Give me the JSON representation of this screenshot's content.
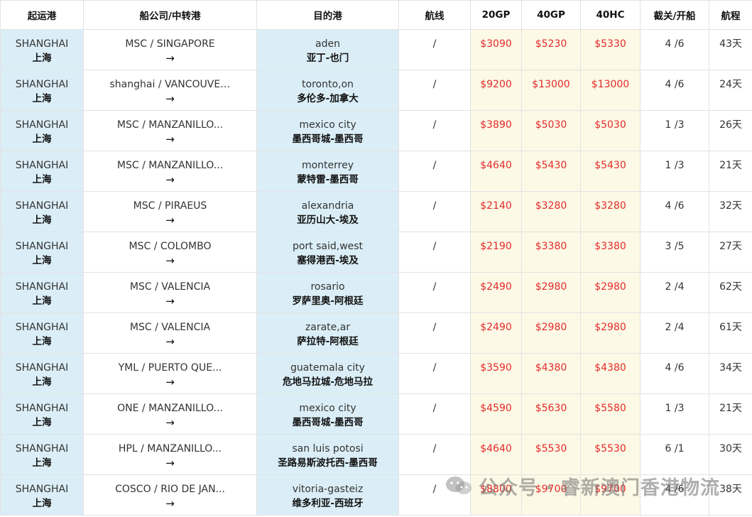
{
  "headers": [
    "起运港",
    "船公司/中转港",
    "目的港",
    "航线",
    "20GP",
    "40GP",
    "40HC",
    "截关/开船",
    "航程"
  ],
  "arrow": "→",
  "rows": [
    {
      "origin_en": "SHANGHAI",
      "origin_cn": "上海",
      "carrier": "MSC / SINGAPORE",
      "dest_en": "aden",
      "dest_cn": "亚丁-也门",
      "route": "/",
      "gp20": "$3090",
      "gp40": "$5230",
      "hc40": "$5330",
      "schedule": "4 /6",
      "days": "43天"
    },
    {
      "origin_en": "SHANGHAI",
      "origin_cn": "上海",
      "carrier": "shanghai / VANCOUVER,...",
      "dest_en": "toronto,on",
      "dest_cn": "多伦多-加拿大",
      "route": "/",
      "gp20": "$9200",
      "gp40": "$13000",
      "hc40": "$13000",
      "schedule": "4 /6",
      "days": "24天"
    },
    {
      "origin_en": "SHANGHAI",
      "origin_cn": "上海",
      "carrier": "MSC / MANZANILLO...",
      "dest_en": "mexico city",
      "dest_cn": "墨西哥城-墨西哥",
      "route": "/",
      "gp20": "$3890",
      "gp40": "$5030",
      "hc40": "$5030",
      "schedule": "1 /3",
      "days": "26天"
    },
    {
      "origin_en": "SHANGHAI",
      "origin_cn": "上海",
      "carrier": "MSC / MANZANILLO...",
      "dest_en": "monterrey",
      "dest_cn": "蒙特雷-墨西哥",
      "route": "/",
      "gp20": "$4640",
      "gp40": "$5430",
      "hc40": "$5430",
      "schedule": "1 /3",
      "days": "21天"
    },
    {
      "origin_en": "SHANGHAI",
      "origin_cn": "上海",
      "carrier": "MSC / PIRAEUS",
      "dest_en": "alexandria",
      "dest_cn": "亚历山大-埃及",
      "route": "/",
      "gp20": "$2140",
      "gp40": "$3280",
      "hc40": "$3280",
      "schedule": "4 /6",
      "days": "32天"
    },
    {
      "origin_en": "SHANGHAI",
      "origin_cn": "上海",
      "carrier": "MSC / COLOMBO",
      "dest_en": "port said,west",
      "dest_cn": "塞得港西-埃及",
      "route": "/",
      "gp20": "$2190",
      "gp40": "$3380",
      "hc40": "$3380",
      "schedule": "3 /5",
      "days": "27天"
    },
    {
      "origin_en": "SHANGHAI",
      "origin_cn": "上海",
      "carrier": "MSC / VALENCIA",
      "dest_en": "rosario",
      "dest_cn": "罗萨里奥-阿根廷",
      "route": "/",
      "gp20": "$2490",
      "gp40": "$2980",
      "hc40": "$2980",
      "schedule": "2 /4",
      "days": "62天"
    },
    {
      "origin_en": "SHANGHAI",
      "origin_cn": "上海",
      "carrier": "MSC / VALENCIA",
      "dest_en": "zarate,ar",
      "dest_cn": "萨拉特-阿根廷",
      "route": "/",
      "gp20": "$2490",
      "gp40": "$2980",
      "hc40": "$2980",
      "schedule": "2 /4",
      "days": "61天"
    },
    {
      "origin_en": "SHANGHAI",
      "origin_cn": "上海",
      "carrier": "YML / PUERTO QUE...",
      "dest_en": "guatemala city",
      "dest_cn": "危地马拉城-危地马拉",
      "route": "/",
      "gp20": "$3590",
      "gp40": "$4380",
      "hc40": "$4380",
      "schedule": "4 /6",
      "days": "34天"
    },
    {
      "origin_en": "SHANGHAI",
      "origin_cn": "上海",
      "carrier": "ONE / MANZANILLO...",
      "dest_en": "mexico city",
      "dest_cn": "墨西哥城-墨西哥",
      "route": "/",
      "gp20": "$4590",
      "gp40": "$5630",
      "hc40": "$5580",
      "schedule": "1 /3",
      "days": "21天"
    },
    {
      "origin_en": "SHANGHAI",
      "origin_cn": "上海",
      "carrier": "HPL / MANZANILLO...",
      "dest_en": "san luis potosi",
      "dest_cn": "圣路易斯波托西-墨西哥",
      "route": "/",
      "gp20": "$4640",
      "gp40": "$5530",
      "hc40": "$5530",
      "schedule": "6 /1",
      "days": "30天"
    },
    {
      "origin_en": "SHANGHAI",
      "origin_cn": "上海",
      "carrier": "COSCO / RIO DE JAN...",
      "dest_en": "vitoria-gasteiz",
      "dest_cn": "维多利亚-西班牙",
      "route": "/",
      "gp20": "$8800",
      "gp40": "$9700",
      "hc40": "$9700",
      "schedule": "4 /6",
      "days": "38天"
    }
  ],
  "watermark": "公众号 · 睿新澳门香港物流",
  "colors": {
    "price": "#e42a2a",
    "port_bg": "#dbeef7",
    "price_bg": "#fcf9e6"
  }
}
